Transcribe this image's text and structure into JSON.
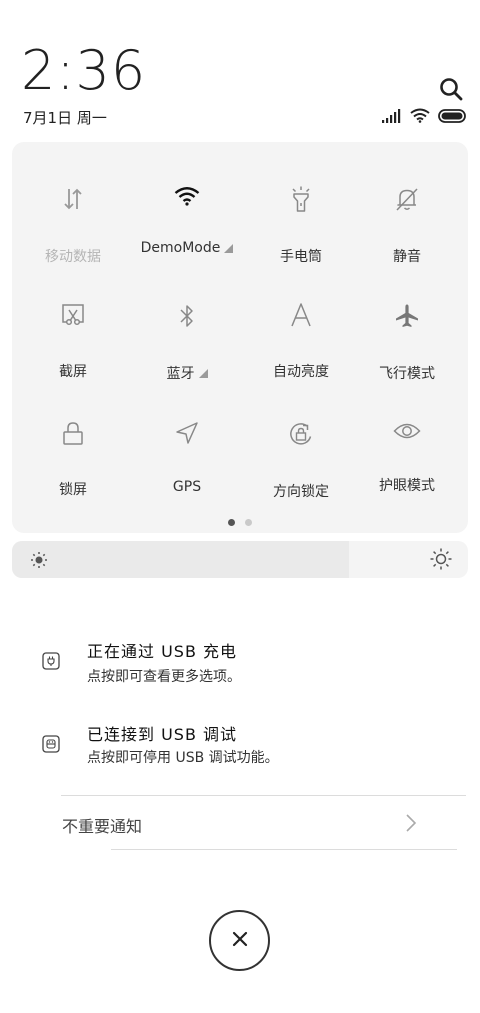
{
  "status": {
    "time": "2:36",
    "date": "7月1日 周一"
  },
  "quick_settings": {
    "tiles": [
      {
        "label": "移动数据",
        "icon": "mobile-data-icon",
        "dim": true
      },
      {
        "label": "DemoMode",
        "icon": "wifi-icon",
        "dim": false
      },
      {
        "label": "手电筒",
        "icon": "flashlight-icon",
        "dim": false
      },
      {
        "label": "静音",
        "icon": "mute-bell-icon",
        "dim": false
      },
      {
        "label": "截屏",
        "icon": "screenshot-icon",
        "dim": false
      },
      {
        "label": "蓝牙",
        "icon": "bluetooth-icon",
        "dim": false
      },
      {
        "label": "自动亮度",
        "icon": "auto-brightness-icon",
        "dim": false
      },
      {
        "label": "飞行模式",
        "icon": "airplane-icon",
        "dim": false
      },
      {
        "label": "锁屏",
        "icon": "lock-icon",
        "dim": false
      },
      {
        "label": "GPS",
        "icon": "gps-icon",
        "dim": false
      },
      {
        "label": "方向锁定",
        "icon": "rotation-lock-icon",
        "dim": false
      },
      {
        "label": "护眼模式",
        "icon": "eye-icon",
        "dim": false
      }
    ],
    "page_count": 2,
    "current_page": 1
  },
  "brightness": {
    "level": 0.74
  },
  "notifications": [
    {
      "title": "正在通过 USB 充电",
      "subtitle": "点按即可查看更多选项。",
      "icon": "usb-charge-icon"
    },
    {
      "title": "已连接到 USB 调试",
      "subtitle": "点按即可停用 USB 调试功能。",
      "icon": "usb-debug-icon"
    }
  ],
  "unimportant": {
    "label": "不重要通知"
  },
  "colors": {
    "panel_bg": "#f4f4f4",
    "text": "#222222",
    "dim_text": "#b5b5b5"
  }
}
